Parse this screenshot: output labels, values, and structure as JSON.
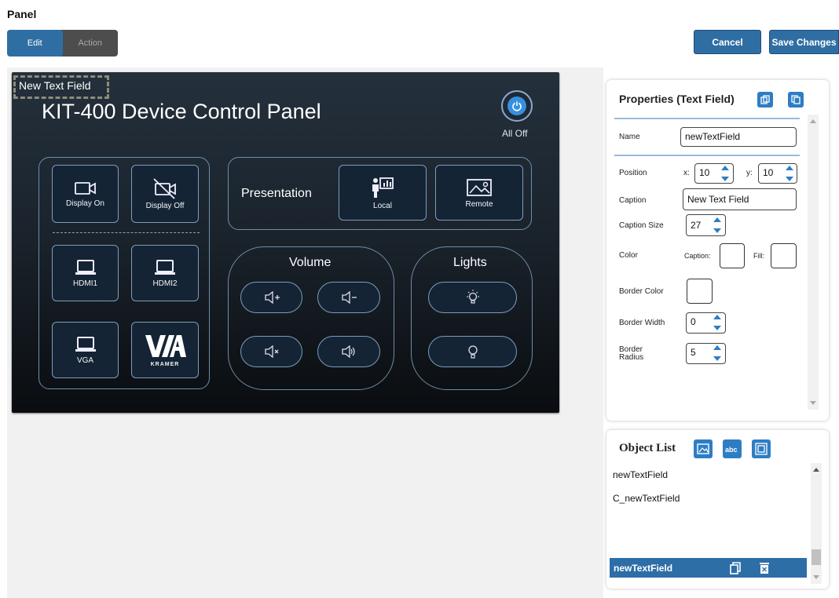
{
  "page": {
    "title": "Panel"
  },
  "mode": {
    "edit_label": "Edit",
    "action_label": "Action",
    "active": "edit"
  },
  "top_actions": {
    "cancel_label": "Cancel",
    "save_label": "Save Changes"
  },
  "device_panel": {
    "selected_text_field": "New Text Field",
    "heading": "KIT-400 Device Control Panel",
    "all_off_label": "All Off",
    "display": {
      "on_label": "Display On",
      "off_label": "Display Off"
    },
    "inputs": [
      {
        "label": "HDMI1",
        "icon": "laptop-icon"
      },
      {
        "label": "HDMI2",
        "icon": "laptop-icon"
      },
      {
        "label": "VGA",
        "icon": "laptop-icon"
      }
    ],
    "logo_text": "KRAMER",
    "presentation": {
      "label": "Presentation",
      "local_label": "Local",
      "remote_label": "Remote"
    },
    "volume": {
      "label": "Volume"
    },
    "lights": {
      "label": "Lights"
    }
  },
  "properties": {
    "title": "Properties (Text Field)",
    "name_label": "Name",
    "name_value": "newTextField",
    "position_label": "Position",
    "x_label": "x:",
    "x_value": "10",
    "y_label": "y:",
    "y_value": "10",
    "caption_label": "Caption",
    "caption_value": "New Text Field",
    "caption_size_label": "Caption Size",
    "caption_size_value": "27",
    "color_label": "Color",
    "color_caption_label": "Caption:",
    "color_fill_label": "Fill:",
    "border_color_label": "Border Color",
    "border_width_label": "Border Width",
    "border_width_value": "0",
    "border_radius_label": "Border\nRadius",
    "border_radius_value": "5"
  },
  "object_list": {
    "title": "Object List",
    "items": [
      "newTextField",
      "C_newTextField"
    ],
    "selected": "newTextField"
  },
  "colors": {
    "accent": "#2f6ea3",
    "panel_bg": "#1b242d",
    "tile_border": "#7d9cbd",
    "power_blue": "#3690de"
  }
}
